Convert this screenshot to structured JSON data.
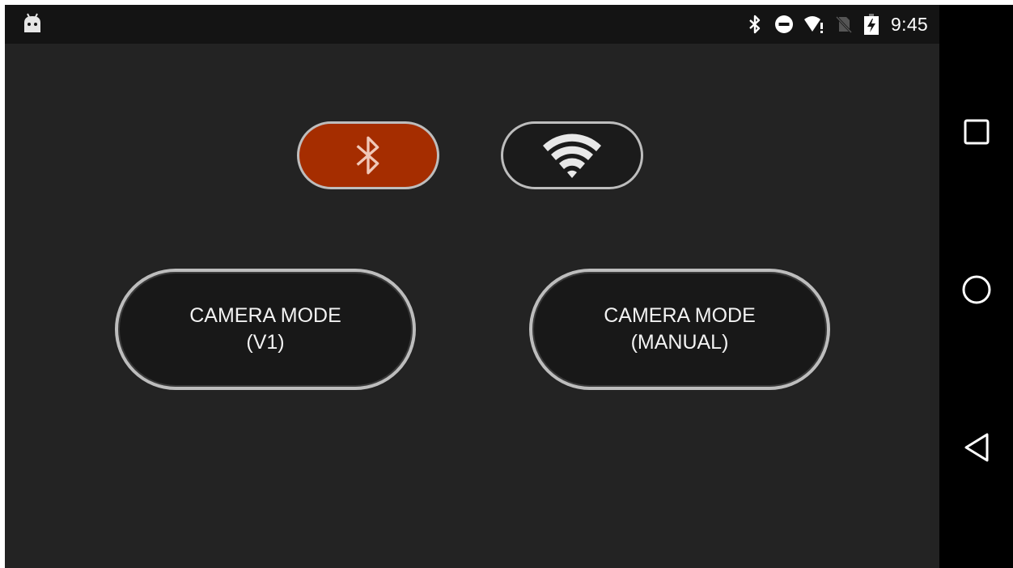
{
  "status_bar": {
    "left_icons": [
      "android-debug-icon"
    ],
    "right_icons": [
      "bluetooth-icon",
      "do-not-disturb-icon",
      "wifi-alert-icon",
      "no-sim-icon",
      "battery-charging-icon"
    ],
    "time": "9:45"
  },
  "app": {
    "toggles": [
      {
        "name": "bluetooth-toggle",
        "icon": "bluetooth-icon",
        "active": true,
        "color": "#a52d00"
      },
      {
        "name": "wifi-toggle",
        "icon": "wifi-icon",
        "active": false,
        "color": "#1b1b1b"
      }
    ],
    "buttons": {
      "v1": {
        "line1": "CAMERA MODE",
        "line2": "(V1)"
      },
      "manual": {
        "line1": "CAMERA MODE",
        "line2": "(MANUAL)"
      }
    }
  },
  "nav_bar": {
    "buttons": [
      "recents-icon",
      "home-icon",
      "back-icon"
    ]
  },
  "colors": {
    "status_bar_bg": "#141414",
    "app_bg": "#232323",
    "accent": "#a52d00",
    "border": "#bdbdbd"
  }
}
